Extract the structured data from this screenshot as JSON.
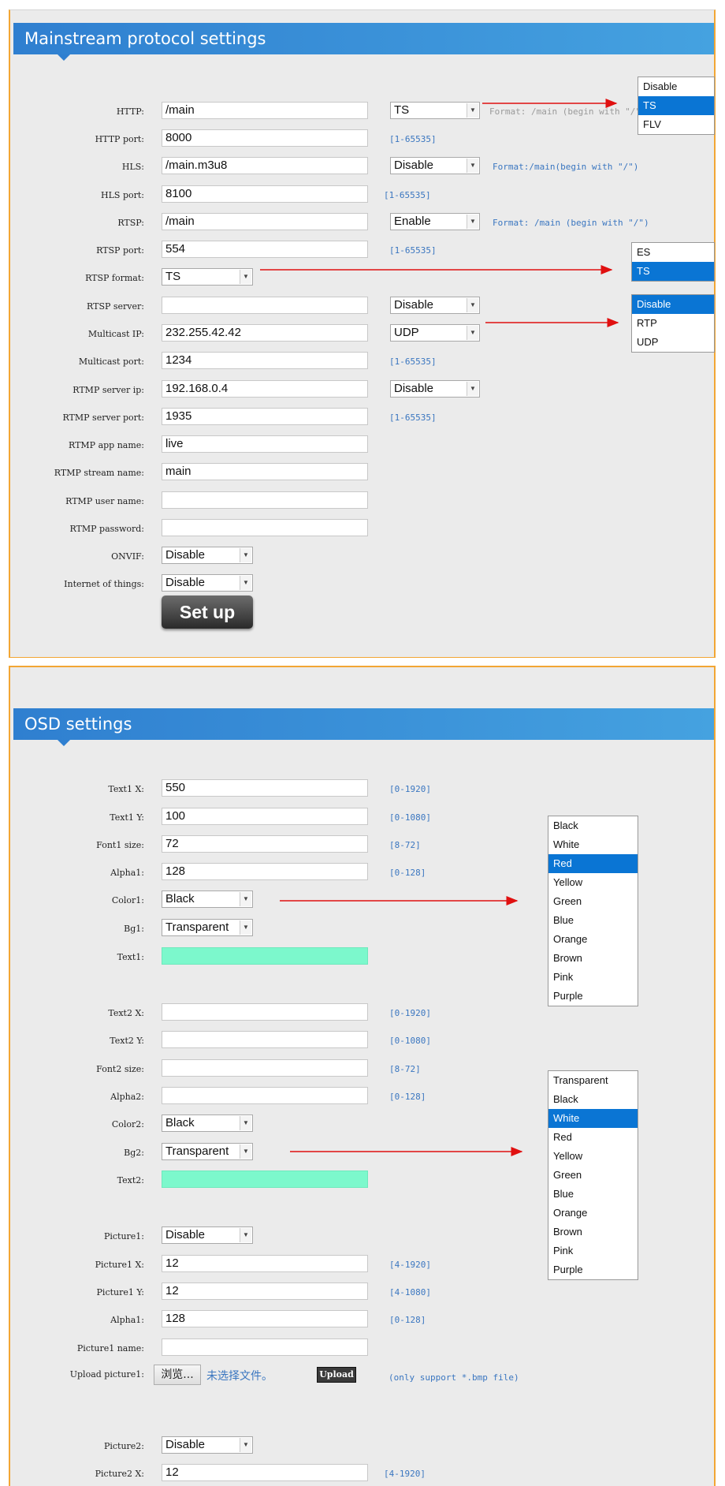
{
  "mainstream": {
    "title": "Mainstream protocol settings",
    "rows": [
      {
        "label": "HTTP:",
        "value": "/main",
        "select": "TS",
        "hint": "Format: /main (begin with \"/\")"
      },
      {
        "label": "HTTP port:",
        "value": "8000",
        "range": "[1-65535]"
      },
      {
        "label": "HLS:",
        "value": "/main.m3u8",
        "select": "Disable",
        "hint": "Format:/main(begin with \"/\")"
      },
      {
        "label": "HLS port:",
        "value": "8100",
        "range": "[1-65535]"
      },
      {
        "label": "RTSP:",
        "value": "/main",
        "select": "Enable",
        "hint": "Format: /main (begin with \"/\")"
      },
      {
        "label": "RTSP port:",
        "value": "554",
        "range": "[1-65535]"
      },
      {
        "label": "RTSP format:",
        "small_select": "TS"
      },
      {
        "label": "RTSP server:",
        "value": "",
        "select": "Disable"
      },
      {
        "label": "Multicast IP:",
        "value": "232.255.42.42",
        "select": "UDP"
      },
      {
        "label": "Multicast port:",
        "value": "1234",
        "range": "[1-65535]"
      },
      {
        "label": "RTMP server ip:",
        "value": "192.168.0.4",
        "select": "Disable"
      },
      {
        "label": "RTMP server port:",
        "value": "1935",
        "range": "[1-65535]"
      },
      {
        "label": "RTMP app name:",
        "value": "live"
      },
      {
        "label": "RTMP stream name:",
        "value": "main"
      },
      {
        "label": "RTMP user name:",
        "value": ""
      },
      {
        "label": "RTMP password:",
        "value": ""
      },
      {
        "label": "ONVIF:",
        "small_select": "Disable"
      },
      {
        "label": "Internet of things:",
        "small_select": "Disable"
      }
    ],
    "setup_label": "Set up",
    "http_dropdown": [
      "Disable",
      "TS",
      "FLV"
    ],
    "rtsp_format_dropdown": [
      "ES",
      "TS"
    ],
    "multicast_dropdown": [
      "Disable",
      "RTP",
      "UDP"
    ]
  },
  "osd": {
    "title": "OSD settings",
    "rows": [
      {
        "label": "Text1 X:",
        "value": "550",
        "range": "[0-1920]"
      },
      {
        "label": "Text1 Y:",
        "value": "100",
        "range": "[0-1080]"
      },
      {
        "label": "Font1 size:",
        "value": "72",
        "range": "[8-72]"
      },
      {
        "label": "Alpha1:",
        "value": "128",
        "range": "[0-128]"
      },
      {
        "label": "Color1:",
        "small_select": "Black"
      },
      {
        "label": "Bg1:",
        "small_select": "Transparent"
      },
      {
        "label": "Text1:",
        "mint": ""
      },
      {
        "label": "Text2 X:",
        "value": "",
        "range": "[0-1920]"
      },
      {
        "label": "Text2 Y:",
        "value": "",
        "range": "[0-1080]"
      },
      {
        "label": "Font2 size:",
        "value": "",
        "range": "[8-72]"
      },
      {
        "label": "Alpha2:",
        "value": "",
        "range": "[0-128]"
      },
      {
        "label": "Color2:",
        "small_select": "Black"
      },
      {
        "label": "Bg2:",
        "small_select": "Transparent"
      },
      {
        "label": "Text2:",
        "mint": ""
      },
      {
        "label": "Picture1:",
        "small_select": "Disable"
      },
      {
        "label": "Picture1 X:",
        "value": "12",
        "range": "[4-1920]"
      },
      {
        "label": "Picture1 Y:",
        "value": "12",
        "range": "[4-1080]"
      },
      {
        "label": "Alpha1:",
        "value": "128",
        "range": "[0-128]"
      },
      {
        "label": "Picture1 name:",
        "value": ""
      },
      {
        "label": "Upload picture1:"
      },
      {
        "label": "Picture2:",
        "small_select": "Disable"
      },
      {
        "label": "Picture2 X:",
        "value": "12",
        "range": "[4-1920]"
      }
    ],
    "browse_label": "浏览...",
    "no_file_label": "未选择文件。",
    "upload_label": "Upload",
    "upload_hint": "(only support *.bmp file)",
    "color_dropdown": [
      "Black",
      "White",
      "Red",
      "Yellow",
      "Green",
      "Blue",
      "Orange",
      "Brown",
      "Pink",
      "Purple"
    ],
    "bg_dropdown": [
      "Transparent",
      "Black",
      "White",
      "Red",
      "Yellow",
      "Green",
      "Blue",
      "Orange",
      "Brown",
      "Pink",
      "Purple"
    ]
  },
  "colors": {
    "accent": "#2f7fd0",
    "border": "#f2a634",
    "highlight": "#0a75d4",
    "mint": "#7cf8cc",
    "arrow": "#e01010"
  }
}
